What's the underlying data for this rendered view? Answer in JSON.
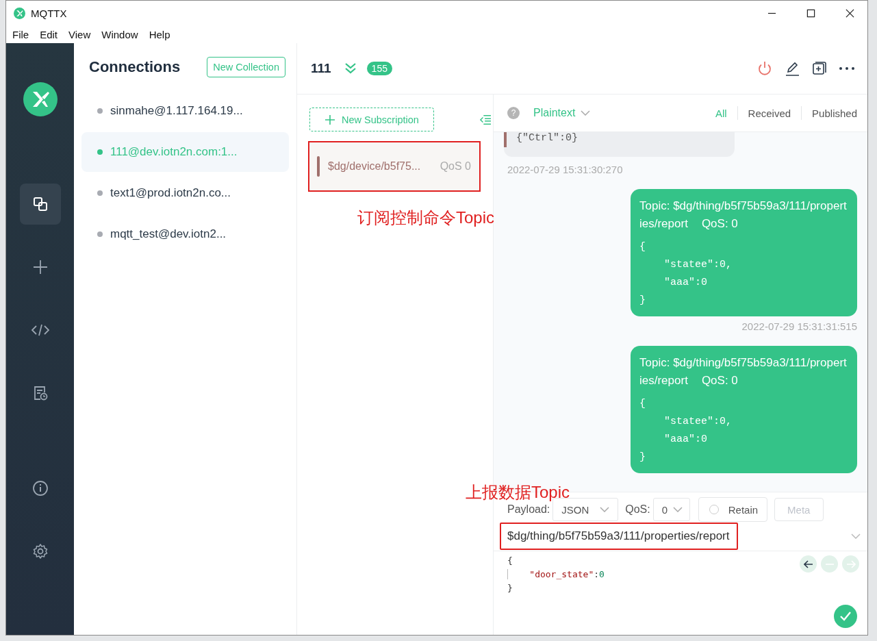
{
  "window": {
    "title": "MQTTX"
  },
  "menu": [
    "File",
    "Edit",
    "View",
    "Window",
    "Help"
  ],
  "nav": [
    {
      "kind": "connections",
      "selected": true
    },
    {
      "kind": "new",
      "selected": false
    },
    {
      "kind": "script",
      "selected": false
    },
    {
      "kind": "log",
      "selected": false
    },
    {
      "kind": "about",
      "selected": false
    },
    {
      "kind": "settings",
      "selected": false
    }
  ],
  "connections": {
    "title": "Connections",
    "new_button": "New Collection",
    "items": [
      {
        "name": "sinmahe@1.117.164.19...",
        "connected": false,
        "selected": false
      },
      {
        "name": "111@dev.iotn2n.com:1...",
        "connected": true,
        "selected": true
      },
      {
        "name": "text1@prod.iotn2n.co...",
        "connected": false,
        "selected": false
      },
      {
        "name": "mqtt_test@dev.iotn2...",
        "connected": false,
        "selected": false
      }
    ]
  },
  "header": {
    "name": "111",
    "count": "155"
  },
  "subscriptions": {
    "new_button": "New Subscription",
    "items": [
      {
        "topic": "$dg/device/b5f75...",
        "qos": "QoS 0",
        "color": "#a0706c"
      }
    ]
  },
  "filter": {
    "help": "?",
    "format": "Plaintext",
    "tabs": [
      {
        "label": "All",
        "selected": true
      },
      {
        "label": "Received",
        "selected": false
      },
      {
        "label": "Published",
        "selected": false
      }
    ]
  },
  "messages": [
    {
      "kind": "received",
      "payload": "{\"Ctrl\":0}",
      "time": "2022-07-29 15:31:30:270",
      "color": "#a0706c"
    },
    {
      "kind": "sent",
      "topic": "Topic: $dg/thing/b5f75b59a3/111/properties/report",
      "qos": "QoS: 0",
      "payload": "{\n    \"statee\":0,\n    \"aaa\":0\n}",
      "time": "2022-07-29 15:31:31:515"
    },
    {
      "kind": "sent",
      "topic": "Topic: $dg/thing/b5f75b59a3/111/properties/report",
      "qos": "QoS: 0",
      "payload": "{\n    \"statee\":0,\n    \"aaa\":0\n}"
    }
  ],
  "publish": {
    "payload_label": "Payload:",
    "format": "JSON",
    "qos_label": "QoS:",
    "qos": "0",
    "retain": {
      "label": "Retain",
      "checked": false
    },
    "meta": {
      "label": "Meta",
      "disabled": true
    },
    "topic": "$dg/thing/b5f75b59a3/111/properties/report",
    "body": {
      "open": "{",
      "key": "\"door_state\"",
      "sep": ":",
      "value": "0",
      "close": "}"
    }
  },
  "annotations": [
    {
      "text": "订阅控制命令Topic"
    },
    {
      "text": "上报数据Topic"
    }
  ]
}
